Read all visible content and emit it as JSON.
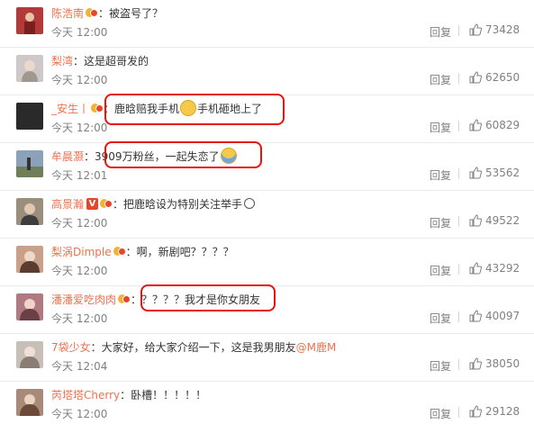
{
  "comments": [
    {
      "user": "陈浩南",
      "content": "被盗号了？",
      "time": "今天 12:00",
      "reply": "回复",
      "likes": "73428",
      "avatar_color": "#b33a3a",
      "badges": [
        "crown"
      ]
    },
    {
      "user": "梨湾",
      "content": "这是超哥发的",
      "time": "今天 12:00",
      "reply": "回复",
      "likes": "62650",
      "avatar_color": "#cfc8c8",
      "badges": []
    },
    {
      "user": "_安生丨",
      "content": "鹿晗赔我手机",
      "content_after": "手机砸地上了",
      "time": "今天 12:00",
      "reply": "回复",
      "likes": "60829",
      "avatar_color": "#2a2a2a",
      "badges": [
        "crown"
      ]
    },
    {
      "user": "牟晨灏",
      "content": "3909万粉丝，一起失恋了",
      "time": "今天 12:01",
      "reply": "回复",
      "likes": "53562",
      "avatar_color": "#8ba2b8",
      "badges": []
    },
    {
      "user": "高景瀚",
      "content": "把鹿晗设为特别关注举手",
      "time": "今天 12:00",
      "reply": "回复",
      "likes": "49522",
      "avatar_color": "#9a8f7c",
      "badges": [
        "V",
        "crown"
      ]
    },
    {
      "user": "梨涡Dimple",
      "content": "啊，新剧吧？？？？",
      "time": "今天 12:00",
      "reply": "回复",
      "likes": "43292",
      "avatar_color": "#c9a08a",
      "badges": [
        "crown"
      ]
    },
    {
      "user": "潘潘爱吃肉肉",
      "content": "？？？？我才是你女朋友",
      "time": "今天 12:00",
      "reply": "回复",
      "likes": "40097",
      "avatar_color": "#b07a82",
      "badges": [
        "crown"
      ]
    },
    {
      "user": "7袋少女",
      "content": "大家好，给大家介绍一下，这是我男朋友",
      "mention": "@M鹿M",
      "time": "今天 12:04",
      "reply": "回复",
      "likes": "38050",
      "avatar_color": "#c8c0b8",
      "badges": []
    },
    {
      "user": "芮塔塔Cherry",
      "content": "卧槽！！！！！",
      "time": "今天 12:00",
      "reply": "回复",
      "likes": "29128",
      "avatar_color": "#a88a78",
      "badges": []
    }
  ],
  "colors": {
    "username": "#eb7350",
    "highlight": "#e8120c",
    "meta": "#808080"
  }
}
